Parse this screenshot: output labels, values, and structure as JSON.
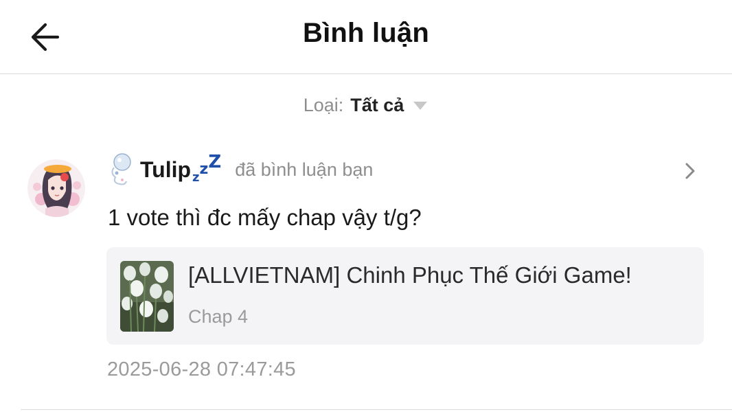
{
  "header": {
    "title": "Bình luận",
    "back_icon": "arrow-left-icon"
  },
  "filter": {
    "label": "Loại:",
    "value": "Tất cả",
    "caret_icon": "caret-down-icon"
  },
  "comment": {
    "username": "Tulip",
    "username_suffix": [
      "z",
      "z",
      "Z"
    ],
    "action": "đã bình luận bạn",
    "text": "1 vote thì đc mấy chap vậy t/g?",
    "story": {
      "title": "[ALLVIETNAM] Chinh Phục Thế Giới Game!",
      "chapter": "Chap 4"
    },
    "timestamp": "2025-06-28 07:47:45",
    "chevron_icon": "chevron-right-icon"
  },
  "colors": {
    "text_primary": "#111111",
    "text_secondary": "#8e8e8e",
    "card_background": "#f4f4f6",
    "divider": "#d9d9d9",
    "zz_accent": "#1f4fa8"
  }
}
